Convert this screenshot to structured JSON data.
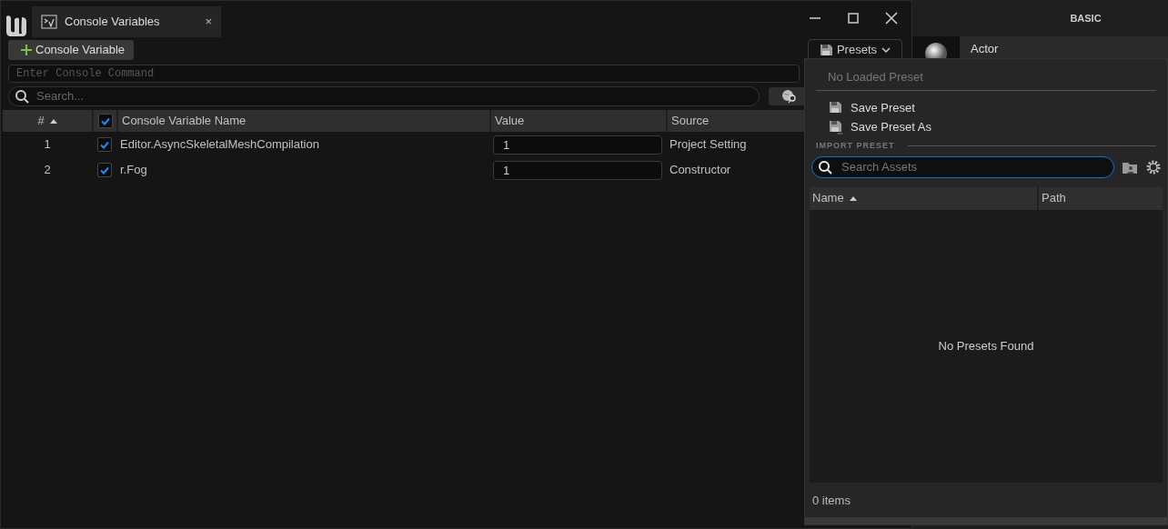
{
  "tab": {
    "title": "Console Variables",
    "close": "×"
  },
  "toolbar": {
    "add_button": "Console Variable",
    "presets_button": "Presets"
  },
  "command_field": {
    "placeholder": "Enter Console Command"
  },
  "search_field": {
    "placeholder": "Search..."
  },
  "table": {
    "columns": [
      "#",
      "Console Variable Name",
      "Value",
      "Source"
    ],
    "all_checked": true,
    "rows": [
      {
        "index": "1",
        "checked": true,
        "name": "Editor.AsyncSkeletalMeshCompilation",
        "value": "1",
        "source": "Project Setting"
      },
      {
        "index": "2",
        "checked": true,
        "name": "r.Fog",
        "value": "1",
        "source": "Constructor"
      }
    ]
  },
  "side_panel": {
    "tab": "BASIC",
    "item": "Actor"
  },
  "presets_menu": {
    "status": "No Loaded Preset",
    "items": [
      "Save Preset",
      "Save Preset As"
    ],
    "section": "IMPORT PRESET",
    "search": {
      "placeholder": "Search Assets"
    },
    "columns": [
      "Name",
      "Path"
    ],
    "empty_text": "No Presets Found",
    "count": "0 items"
  }
}
